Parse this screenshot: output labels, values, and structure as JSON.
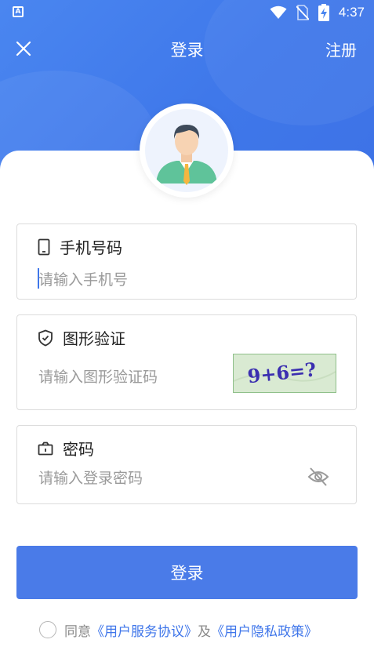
{
  "status_bar": {
    "left_icon_text": "A",
    "time": "4:37"
  },
  "header": {
    "title": "登录",
    "register_label": "注册"
  },
  "fields": {
    "phone": {
      "label": "手机号码",
      "placeholder": "请输入手机号"
    },
    "captcha": {
      "label": "图形验证",
      "placeholder": "请输入图形验证码",
      "image_text": "9+6=?"
    },
    "password": {
      "label": "密码",
      "placeholder": "请输入登录密码"
    }
  },
  "login_button": "登录",
  "agreement": {
    "prefix": "同意",
    "service_link": "《用户服务协议》",
    "middle": "及",
    "privacy_link": "《用户隐私政策》"
  },
  "colors": {
    "primary": "#4a7be8",
    "link": "#3f76ea",
    "captcha_bg": "#d9ead2"
  }
}
